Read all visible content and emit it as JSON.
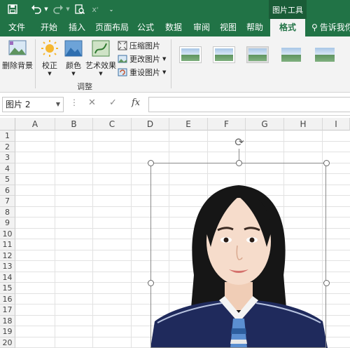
{
  "qat": {
    "save_icon": "save-icon",
    "undo_icon": "undo-icon",
    "redo_icon": "redo-icon",
    "print_preview_icon": "print-preview-icon",
    "subscript_icon": "subscript-icon",
    "more_icon": "customize-qat-icon"
  },
  "context_tab_label": "图片工具",
  "tabs": [
    {
      "label": "文件"
    },
    {
      "label": "开始"
    },
    {
      "label": "插入"
    },
    {
      "label": "页面布局"
    },
    {
      "label": "公式"
    },
    {
      "label": "数据"
    },
    {
      "label": "审阅"
    },
    {
      "label": "视图"
    },
    {
      "label": "帮助"
    },
    {
      "label": "格式"
    }
  ],
  "tellme": "告诉我你",
  "ribbon": {
    "remove_bg": "删除背景",
    "corrections": "校正",
    "color": "颜色",
    "artistic": "艺术效果",
    "compress": "压缩图片",
    "change": "更改图片",
    "reset": "重设图片",
    "adjust_group": "调整"
  },
  "namebox": "图片 2",
  "formula_icons": {
    "cancel": "✕",
    "enter": "✓",
    "fx": "fx"
  },
  "columns": [
    "A",
    "B",
    "C",
    "D",
    "E",
    "F",
    "G",
    "H",
    "I"
  ],
  "rows": [
    "1",
    "2",
    "3",
    "4",
    "5",
    "6",
    "7",
    "8",
    "9",
    "10",
    "11",
    "12",
    "13",
    "14",
    "15",
    "16",
    "17",
    "18",
    "19",
    "20"
  ],
  "colors": {
    "excel_green": "#217346",
    "ribbon_bg": "#f3f3f3"
  }
}
